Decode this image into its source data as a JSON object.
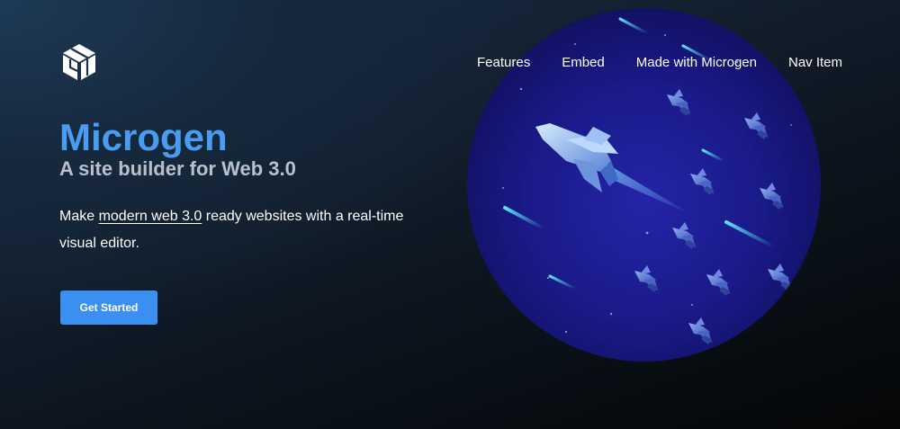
{
  "brand": {
    "logo_icon": "cube-logo-icon"
  },
  "nav": {
    "items": [
      {
        "label": "Features"
      },
      {
        "label": "Embed"
      },
      {
        "label": "Made with Microgen"
      },
      {
        "label": "Nav Item"
      }
    ]
  },
  "hero": {
    "title": "Microgen",
    "subtitle": "A site builder for Web 3.0",
    "description_before": "Make ",
    "description_link": "modern web 3.0",
    "description_after": " ready websites with a real-time visual editor.",
    "cta_label": "Get Started",
    "illustration_icon": "space-shuttles-illustration"
  },
  "colors": {
    "accent": "#3b8ff0",
    "title": "#4a9bf2",
    "subtitle": "#b9c0cc",
    "illustration_bg": "#1a1a8a"
  }
}
